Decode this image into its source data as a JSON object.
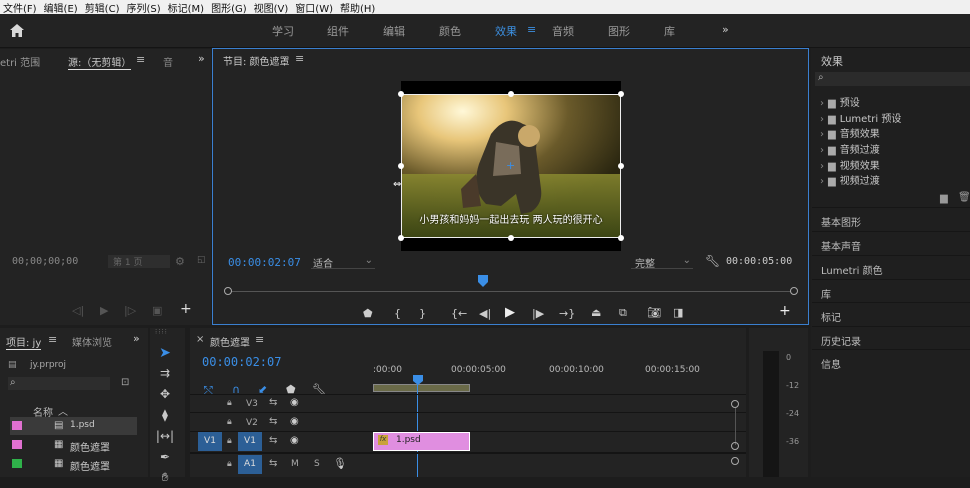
{
  "menu": [
    "文件(F)",
    "编辑(E)",
    "剪辑(C)",
    "序列(S)",
    "标记(M)",
    "图形(G)",
    "视图(V)",
    "窗口(W)",
    "帮助(H)"
  ],
  "workspaces": [
    {
      "label": "学习"
    },
    {
      "label": "组件"
    },
    {
      "label": "编辑"
    },
    {
      "label": "颜色"
    },
    {
      "label": "效果"
    },
    {
      "label": "音频"
    },
    {
      "label": "图形"
    },
    {
      "label": "库"
    }
  ],
  "source_panel": {
    "tab_lumetri": "etri 范围",
    "tab_source": "源:（无剪辑）",
    "tab_audio": "音",
    "timecode": "00;00;00;00",
    "page": "第 1 页"
  },
  "program": {
    "title": "节目: 颜色遮罩",
    "subtitle": "小男孩和妈妈一起出去玩 两人玩的很开心",
    "timecode": "00:00:02:07",
    "fit": "适合",
    "quality": "完整",
    "duration": "00:00:05:00"
  },
  "effects": {
    "title": "效果",
    "items": [
      "预设",
      "Lumetri 预设",
      "音频效果",
      "音频过渡",
      "视频效果",
      "视频过渡"
    ],
    "sections": [
      "基本图形",
      "基本声音",
      "Lumetri 颜色",
      "库",
      "标记",
      "历史记录",
      "信息"
    ]
  },
  "project": {
    "tab_project": "项目: jy",
    "tab_media": "媒体浏览",
    "file": "jy.prproj",
    "col_name": "名称",
    "items": [
      {
        "name": "1.psd",
        "color": "#e070d0"
      },
      {
        "name": "颜色遮罩",
        "color": "#e070d0"
      },
      {
        "name": "颜色遮罩",
        "color": "#2fb24a"
      }
    ]
  },
  "timeline": {
    "title": "颜色遮罩",
    "timecode": "00:00:02:07",
    "ruler": [
      ":00:00",
      "00:00:05:00",
      "00:00:10:00",
      "00:00:15:00"
    ],
    "tracks": {
      "v3": "V3",
      "v2": "V2",
      "v1": "V1",
      "a1": "A1",
      "src_v1": "V1",
      "m": "M",
      "s": "S"
    },
    "clip_label": "1.psd",
    "fx": "fx"
  },
  "meter": {
    "ticks": [
      "0",
      "-12",
      "-24",
      "-36"
    ]
  }
}
